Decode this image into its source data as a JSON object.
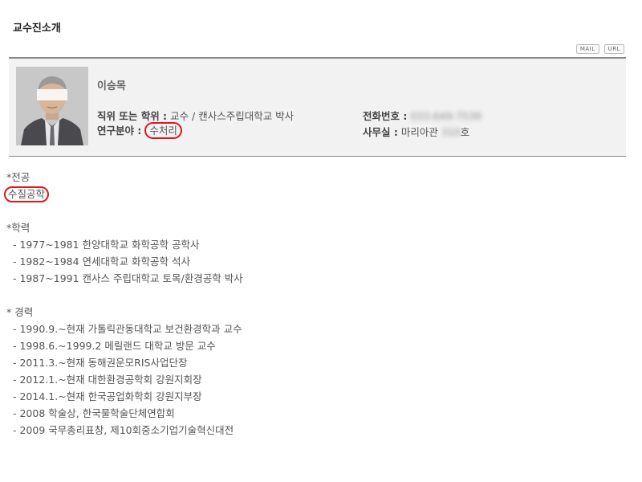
{
  "page": {
    "title": "교수진소개"
  },
  "buttons": {
    "mail": "MAIL",
    "url": "URL"
  },
  "profile": {
    "name": "이승목",
    "position_label": "직위 또는 학위 :",
    "position_value": "교수 / 캔사스주립대학교 박사",
    "research_label": "연구분야 :",
    "research_value": "수처리",
    "phone_label": "전화번호 :",
    "phone_value": "033-649-7539",
    "office_label": "사무실 :",
    "office_value_prefix": "마리아관",
    "office_value_hidden": "310",
    "office_value_suffix": "호"
  },
  "major": {
    "title": "*전공",
    "value": "수질공학"
  },
  "education": {
    "title": "*학력",
    "items": [
      "- 1977~1981 한양대학교 화학공학 공학사",
      "- 1982~1984 연세대학교 화학공학 석사",
      "- 1987~1991 캔사스 주립대학교 토목/환경공학 박사"
    ]
  },
  "career": {
    "title": "* 경력",
    "items": [
      "- 1990.9.~현재 가톨릭관동대학교 보건환경학과 교수",
      "- 1998.6.~1999.2 메릴랜드 대학교 방문 교수",
      "- 2011.3.~현재 동해권운모RIS사업단장",
      "- 2012.1.~현재 대한환경공학회 강원지회장",
      "- 2014.1.~현재 한국공업화학회 강원지부장",
      "- 2008 학술상, 한국물학술단체연합회",
      "- 2009 국무총리표창, 제10회중소기업기술혁신대전"
    ]
  },
  "colors": {
    "highlight_circle": "#e0141e",
    "box_background": "#f2f2f2",
    "text": "#555555"
  }
}
